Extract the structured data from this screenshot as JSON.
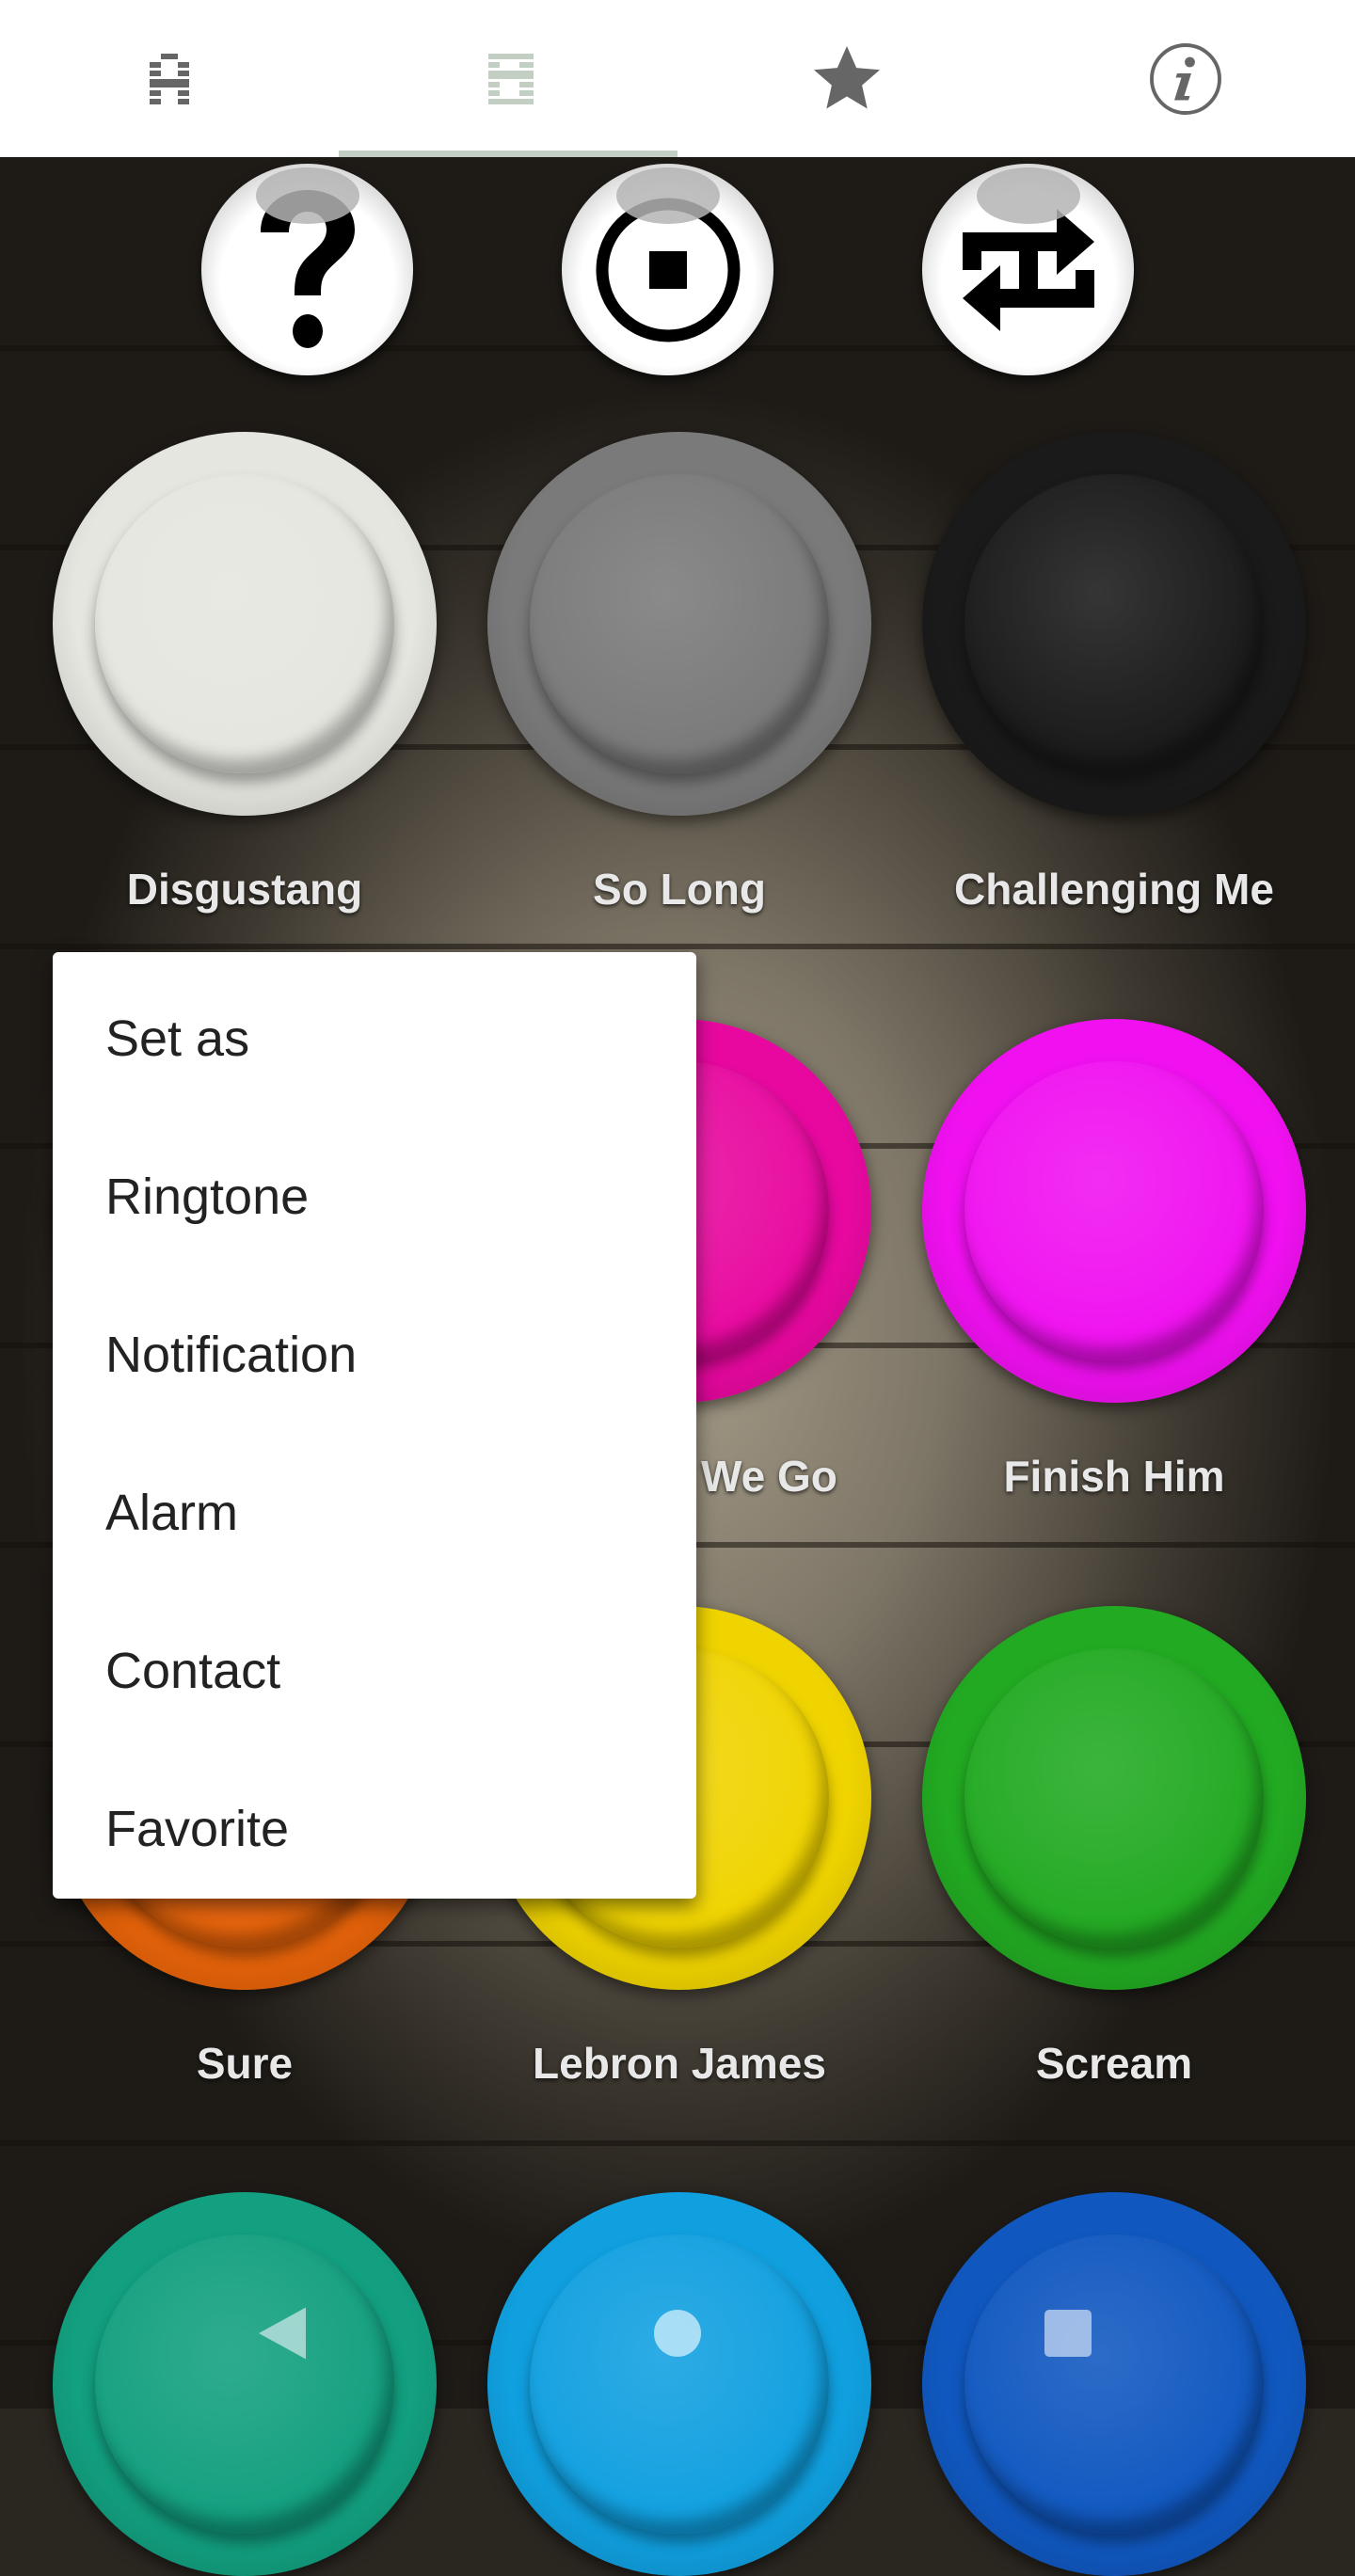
{
  "tabs": [
    {
      "icon": "letter-a-icon"
    },
    {
      "icon": "letter-b-icon",
      "active": true
    },
    {
      "icon": "star-icon"
    },
    {
      "icon": "info-icon"
    }
  ],
  "controls": [
    {
      "icon": "question-icon"
    },
    {
      "icon": "stop-icon"
    },
    {
      "icon": "repeat-one-icon"
    }
  ],
  "buttons": [
    {
      "label": "Disgustang",
      "color": "#e6e6e0"
    },
    {
      "label": "So Long",
      "color": "#7a7a7a"
    },
    {
      "label": "Challenging Me",
      "color": "#1a1a1a"
    },
    {
      "label": "",
      "color": "#e01060"
    },
    {
      "label": "We Go",
      "color": "#e808a0"
    },
    {
      "label": "Finish Him",
      "color": "#f010f0"
    },
    {
      "label": "Sure",
      "color": "#e8640a"
    },
    {
      "label": "Lebron James",
      "color": "#f0d400"
    },
    {
      "label": "Scream",
      "color": "#22aa22"
    },
    {
      "label": "",
      "color": "#12a080"
    },
    {
      "label": "",
      "color": "#10a0e0"
    },
    {
      "label": "",
      "color": "#1058c0"
    }
  ],
  "menu": {
    "items": [
      "Set as",
      "Ringtone",
      "Notification",
      "Alarm",
      "Contact",
      "Favorite"
    ]
  },
  "nav": {
    "back": "back-icon",
    "home": "home-icon",
    "recents": "recents-icon"
  }
}
